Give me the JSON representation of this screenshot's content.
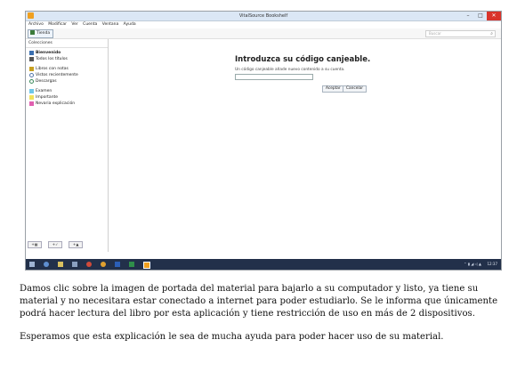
{
  "window": {
    "title": "VitalSource Bookshelf",
    "minimize_icon": "–",
    "maximize_icon": "□",
    "close_icon": "✕"
  },
  "menu": [
    "Archivo",
    "Modificar",
    "Ver",
    "Cuenta",
    "Ventana",
    "Ayuda"
  ],
  "toolbar": {
    "store_label": "Tienda",
    "search_placeholder": "Buscar",
    "search_icon": "⌕"
  },
  "sidebar": {
    "header": "Colecciones",
    "group1": [
      {
        "label": "Bienvenido",
        "icon": "book-icon",
        "color": "#3a6fb0",
        "bold": true
      },
      {
        "label": "Todos los títulos",
        "icon": "books-icon",
        "color": "#555555",
        "bold": false
      }
    ],
    "group2": [
      {
        "label": "Libros con notas",
        "icon": "notes-icon",
        "color": "#c8a020",
        "bold": false
      },
      {
        "label": "Vistos recientemente",
        "icon": "clock-icon",
        "color": "#5577aa",
        "bold": false
      },
      {
        "label": "Descargas",
        "icon": "download-icon",
        "color": "#3a8a5a",
        "bold": false
      }
    ],
    "group3": [
      {
        "label": "Examen",
        "icon": "folder-icon",
        "color": "#6fc7e8",
        "bold": false
      },
      {
        "label": "Importante",
        "icon": "folder-icon",
        "color": "#f2e25a",
        "bold": false
      },
      {
        "label": "Nevaria explicación",
        "icon": "folder-icon",
        "color": "#e05fb0",
        "bold": false
      }
    ],
    "footer_buttons": [
      "+▦",
      "+✓",
      "+▲"
    ]
  },
  "main": {
    "title": "Introduzca su código canjeable.",
    "description": "Un código canjeable añade nuevo contenido a su cuenta.",
    "input_value": "",
    "accept_label": "Aceptar",
    "cancel_label": "Cancelar"
  },
  "taskbar": {
    "tray_icons": "⌃ ▮ ◢ ◁ ▲",
    "clock": "12:37"
  },
  "caption": {
    "paragraph1": "Damos clic sobre la imagen de portada del material para bajarlo a su computador y listo, ya tiene su material y no necesitara estar conectado a internet para poder estudiarlo. Se le informa que únicamente podrá hacer lectura del libro por esta aplicación y tiene restricción de uso en más de 2 dispositivos.",
    "paragraph2": "Esperamos que esta explicación le sea de mucha ayuda para poder hacer uso de su material."
  }
}
